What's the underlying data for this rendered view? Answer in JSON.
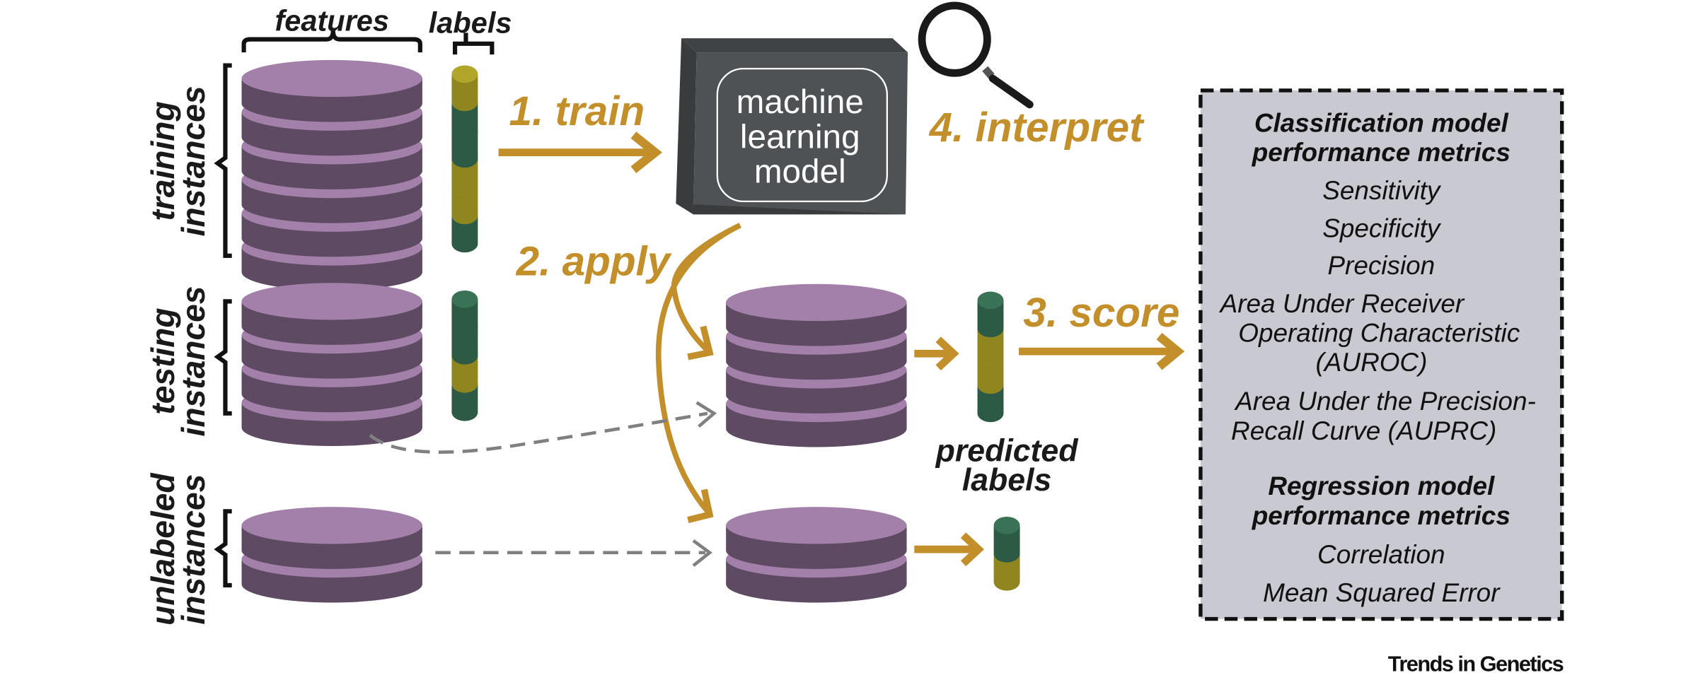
{
  "headers": {
    "features": "features",
    "labels": "labels"
  },
  "row_labels": {
    "training": [
      "training",
      "instances"
    ],
    "testing": [
      "testing",
      "instances"
    ],
    "unlabeled": [
      "unlabeled",
      "instances"
    ]
  },
  "steps": {
    "train": "1. train",
    "apply": "2. apply",
    "score": "3. score",
    "interpret": "4. interpret"
  },
  "model": [
    "machine",
    "learning",
    "model"
  ],
  "predicted_labels": [
    "predicted",
    "labels"
  ],
  "metrics_box": {
    "classification_header": [
      "Classification model",
      "performance metrics"
    ],
    "classification_items": [
      "Sensitivity",
      "Specificity",
      "Precision",
      "Area Under Receiver",
      " Operating Characteristic",
      "(AUROC)",
      "Area Under the Precision-",
      "Recall Curve (AUPRC)"
    ],
    "regression_header": [
      "Regression model",
      "performance metrics"
    ],
    "regression_items": [
      "Correlation",
      "Mean Squared Error"
    ]
  },
  "credit": "Trends in Genetics",
  "label_sequences": {
    "training": [
      "yellow",
      "green",
      "green",
      "yellow",
      "yellow",
      "green"
    ],
    "testing": [
      "green",
      "green",
      "yellow",
      "green"
    ],
    "predicted_testing": [
      "green",
      "yellow",
      "yellow",
      "green"
    ],
    "predicted_unlabeled": [
      "green",
      "yellow"
    ]
  },
  "colors": {
    "accent": "#c38f2b",
    "disk_top": "#a380a9",
    "disk_side": "#5e4a63",
    "label_green": "#3a7256",
    "label_yellow": "#b1a62a",
    "model_face": "#4f5255",
    "box_fill": "#c9c9d2",
    "dashed_arrow": "#808080"
  }
}
